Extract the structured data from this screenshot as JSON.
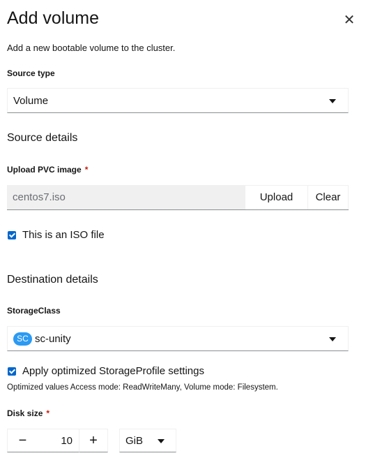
{
  "modal": {
    "title": "Add volume",
    "close_icon": "close-icon",
    "subtitle": "Add a new bootable volume to the cluster."
  },
  "source_type": {
    "label": "Source type",
    "value": "Volume"
  },
  "source_details": {
    "title": "Source details",
    "upload_label": "Upload PVC image",
    "required_mark": "*",
    "file_value": "centos7.iso",
    "upload_button": "Upload",
    "clear_button": "Clear",
    "iso_checkbox_label": "This is an ISO file",
    "iso_checked": true
  },
  "destination_details": {
    "title": "Destination details",
    "storage_class_label": "StorageClass",
    "storage_class_badge": "SC",
    "storage_class_value": "sc-unity",
    "optimize_checkbox_label": "Apply optimized StorageProfile settings",
    "optimize_checked": true,
    "help_text": "Optimized values Access mode: ReadWriteMany, Volume mode: Filesystem.",
    "disk_size_label": "Disk size",
    "required_mark": "*",
    "disk_size_value": "10",
    "minus_label": "−",
    "plus_label": "+",
    "unit_value": "GiB"
  },
  "colors": {
    "accent": "#0066cc",
    "required": "#c9190b",
    "badge": "#2b9af3"
  }
}
